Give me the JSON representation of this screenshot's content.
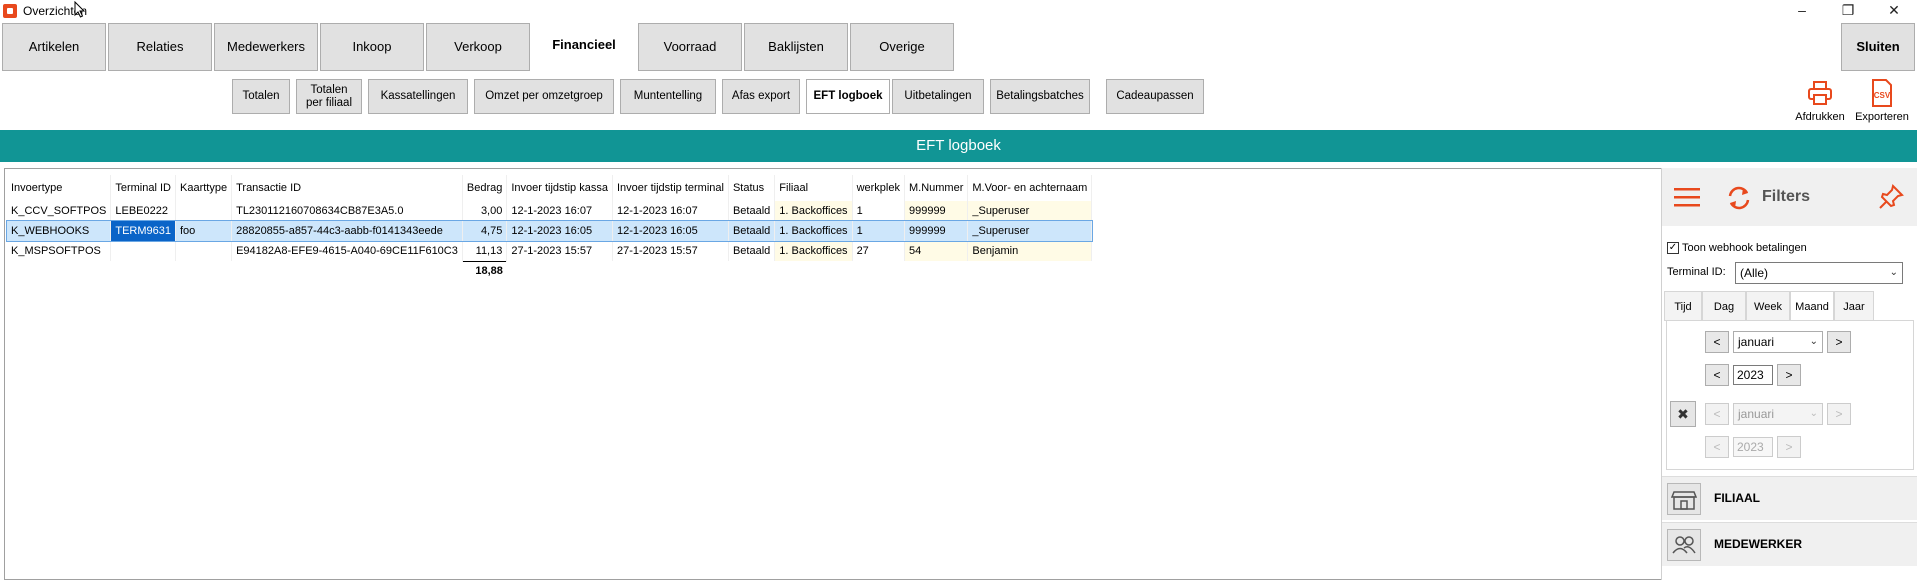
{
  "window": {
    "title": "Overzichten"
  },
  "main_tabs": [
    {
      "label": "Artikelen"
    },
    {
      "label": "Relaties"
    },
    {
      "label": "Medewerkers"
    },
    {
      "label": "Inkoop"
    },
    {
      "label": "Verkoop"
    },
    {
      "label": "Financieel"
    },
    {
      "label": "Voorraad"
    },
    {
      "label": "Baklijsten"
    },
    {
      "label": "Overige"
    }
  ],
  "active_main_tab": "Financieel",
  "close_label": "Sluiten",
  "sub_tabs": [
    {
      "label": "Totalen"
    },
    {
      "label": "Totalen per filiaal"
    },
    {
      "label": "Kassatellingen"
    },
    {
      "label": "Omzet per omzetgroep"
    },
    {
      "label": "Muntentelling"
    },
    {
      "label": "Afas export"
    },
    {
      "label": "EFT logboek"
    },
    {
      "label": "Uitbetalingen"
    },
    {
      "label": "Betalingsbatches"
    },
    {
      "label": "Cadeaupassen"
    }
  ],
  "tools": {
    "print_label": "Afdrukken",
    "export_label": "Exporteren",
    "csv_text": "CSV"
  },
  "header_title": "EFT logboek",
  "grid": {
    "columns": [
      "Invoertype",
      "Terminal ID",
      "Kaarttype",
      "Transactie ID",
      "Bedrag",
      "Invoer tijdstip kassa",
      "Invoer tijdstip terminal",
      "Status",
      "Filiaal",
      "werkplek",
      "M.Nummer",
      "M.Voor- en achternaam"
    ],
    "rows": [
      [
        "K_CCV_SOFTPOS",
        "LEBE0222",
        "",
        "TL230112160708634CB87E3A5.0",
        "3,00",
        "12-1-2023 16:07",
        "12-1-2023 16:07",
        "Betaald",
        "1. Backoffices",
        "1",
        "999999",
        "_Superuser"
      ],
      [
        "K_WEBHOOKS",
        "TERM9631",
        "foo",
        "28820855-a857-44c3-aabb-f0141343eede",
        "4,75",
        "12-1-2023 16:05",
        "12-1-2023 16:05",
        "Betaald",
        "1. Backoffices",
        "1",
        "999999",
        "_Superuser"
      ],
      [
        "K_MSPSOFTPOS",
        "",
        "",
        "E94182A8-EFE9-4615-A040-69CE11F610C3",
        "11,13",
        "27-1-2023 15:57",
        "27-1-2023 15:57",
        "Betaald",
        "1. Backoffices",
        "27",
        "54",
        "Benjamin"
      ]
    ],
    "total": "18,88"
  },
  "filters": {
    "title": "Filters",
    "webhook_label": "Toon webhook betalingen",
    "webhook_checked": "✓",
    "terminal_label": "Terminal ID:",
    "terminal_value": "(Alle)",
    "period_tabs": [
      "Tijd",
      "Dag",
      "Week",
      "Maand",
      "Jaar"
    ],
    "active_period": "Maand",
    "from_month": "januari",
    "from_year": "2023",
    "to_month": "januari",
    "to_year": "2023",
    "sections": [
      "FILIAAL",
      "MEDEWERKER"
    ]
  }
}
